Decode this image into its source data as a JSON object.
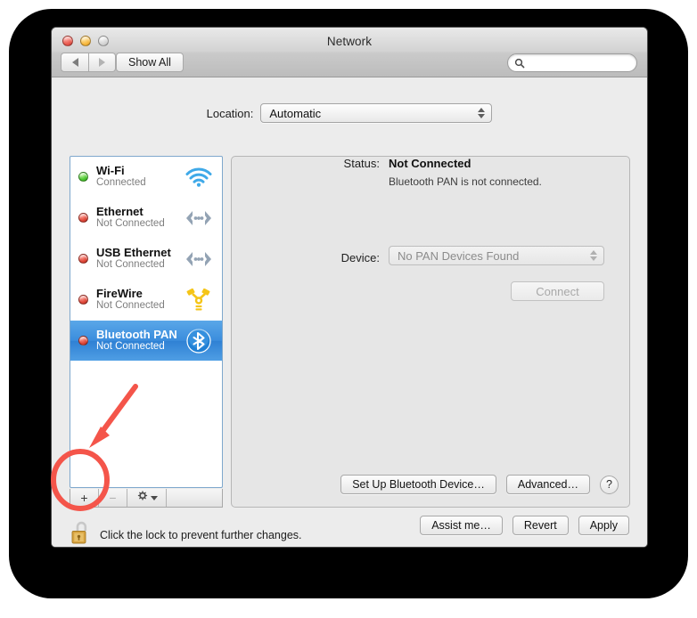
{
  "window": {
    "title": "Network",
    "traffic_lights": [
      "close",
      "minimize",
      "zoom"
    ],
    "nav_back": "back-arrow",
    "nav_forward": "forward-arrow",
    "show_all_label": "Show All",
    "search_placeholder": "",
    "search_value": ""
  },
  "location": {
    "label": "Location:",
    "value": "Automatic"
  },
  "services": [
    {
      "name": "Wi-Fi",
      "status": "Connected",
      "dot": "green",
      "icon": "wifi-icon",
      "selected": false
    },
    {
      "name": "Ethernet",
      "status": "Not Connected",
      "dot": "red",
      "icon": "ethernet-icon",
      "selected": false
    },
    {
      "name": "USB Ethernet",
      "status": "Not Connected",
      "dot": "red",
      "icon": "ethernet-icon",
      "selected": false
    },
    {
      "name": "FireWire",
      "status": "Not Connected",
      "dot": "red",
      "icon": "firewire-icon",
      "selected": false
    },
    {
      "name": "Bluetooth PAN",
      "status": "Not Connected",
      "dot": "red",
      "icon": "bluetooth-icon",
      "selected": true
    }
  ],
  "list_toolbar": {
    "add_label": "+",
    "remove_label": "−",
    "gear_label": "gear-icon"
  },
  "lock": {
    "icon": "unlocked-padlock-icon",
    "text": "Click the lock to prevent further changes."
  },
  "detail": {
    "status_label": "Status:",
    "status_value": "Not Connected",
    "status_description": "Bluetooth PAN is not connected.",
    "device_label": "Device:",
    "device_value": "No PAN Devices Found",
    "connect_label": "Connect",
    "setup_label": "Set Up Bluetooth Device…",
    "advanced_label": "Advanced…",
    "help_label": "?"
  },
  "bottom_buttons": {
    "assist_label": "Assist me…",
    "revert_label": "Revert",
    "apply_label": "Apply"
  },
  "annotation": {
    "color": "#f4554a",
    "arrow": "red-arrow-pointing-to-add-button",
    "circle": "red-ellipse-highlighting-add-button"
  },
  "colors": {
    "selection_blue": "#3b8ddd",
    "annotation_red": "#f4554a",
    "connected_green": "#4cc731",
    "disconnected_red": "#e0483a"
  }
}
